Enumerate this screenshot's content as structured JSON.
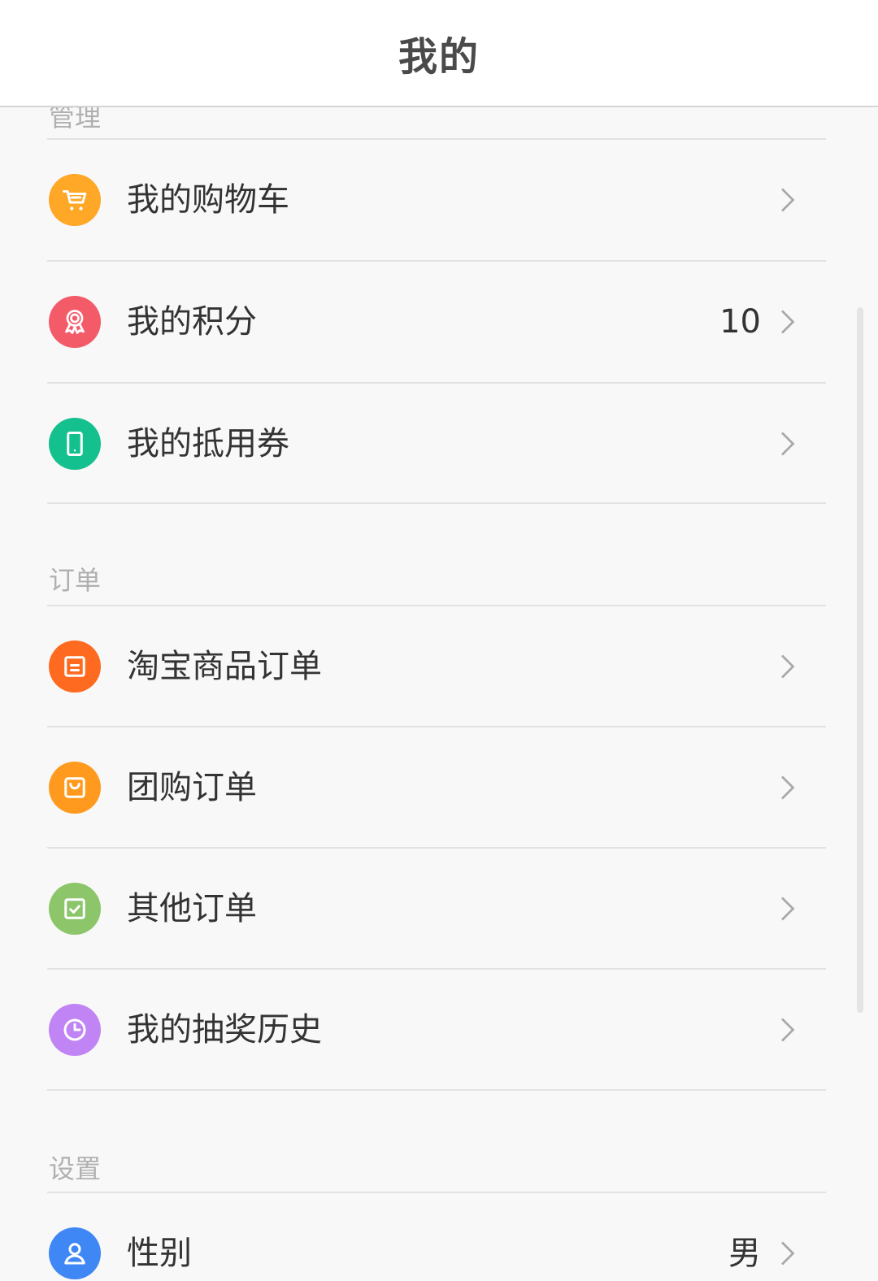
{
  "header": {
    "title": "我的"
  },
  "sections": {
    "manage": {
      "label": "管理"
    },
    "orders": {
      "label": "订单"
    },
    "settings": {
      "label": "设置"
    }
  },
  "items": {
    "cart": {
      "label": "我的购物车",
      "icon": "cart-icon",
      "color": "#ffa726"
    },
    "points": {
      "label": "我的积分",
      "value": "10",
      "icon": "award-icon",
      "color": "#f45b69"
    },
    "coupons": {
      "label": "我的抵用券",
      "icon": "phone-icon",
      "color": "#13c08e"
    },
    "taobao_orders": {
      "label": "淘宝商品订单",
      "icon": "receipt-icon",
      "color": "#fe6a1f"
    },
    "group_orders": {
      "label": "团购订单",
      "icon": "bag-icon",
      "color": "#ff9a1e"
    },
    "other_orders": {
      "label": "其他订单",
      "icon": "check-icon",
      "color": "#8cc56a"
    },
    "lottery_history": {
      "label": "我的抽奖历史",
      "icon": "clock-icon",
      "color": "#c184f4"
    },
    "gender": {
      "label": "性别",
      "value": "男",
      "icon": "user-icon",
      "color": "#3f87f5"
    }
  }
}
